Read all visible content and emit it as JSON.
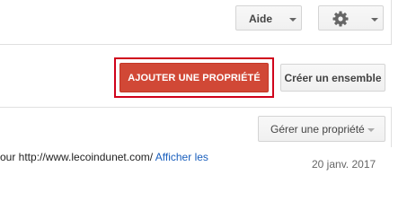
{
  "toolbar": {
    "help_label": "Aide",
    "settings_icon": "gear-icon"
  },
  "actions": {
    "add_property_label": "AJOUTER UNE PROPRIÉTÉ",
    "create_set_label": "Créer un ensemble",
    "manage_property_label": "Gérer une propriété"
  },
  "row": {
    "text": "our http://www.lecoindunet.com/",
    "link": "Afficher les",
    "date": "20 janv. 2017"
  },
  "colors": {
    "primary_button": "#d14836",
    "highlight_border": "#d0021b",
    "link": "#1a5fbd"
  }
}
